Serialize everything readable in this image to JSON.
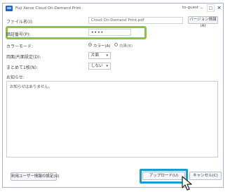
{
  "window": {
    "title": "Fuji Xerox Cloud On-Demand Print",
    "user": "to-guest",
    "minimize": "–",
    "maximize": "□",
    "close": "×"
  },
  "form": {
    "filename_label": "ファイル名(I):",
    "filename_value": "Cloud On-Demand Print.pdf",
    "version_button": "バージョン情報(A)",
    "pin_label": "暗証番号(P):",
    "pin_value": "••••",
    "color_label": "カラーモード:",
    "color_options": [
      "カラー(A)",
      "白黒(B)"
    ],
    "paper_label": "両面/片面設定(D):",
    "paper_value": "片面",
    "collate_label": "まとめて1枚(N):",
    "collate_value": "しない",
    "comment_label": "お知らせ:",
    "comment_text": "お知らせはありません。"
  },
  "footer": {
    "user_info_button": "利用ユーザー情報の設定(U)",
    "upload_button": "アップロード(U)",
    "cancel_button": "キャンセル(C)"
  },
  "colors": {
    "highlight_green": "#8bc34a",
    "highlight_blue": "#1d9ad6"
  }
}
